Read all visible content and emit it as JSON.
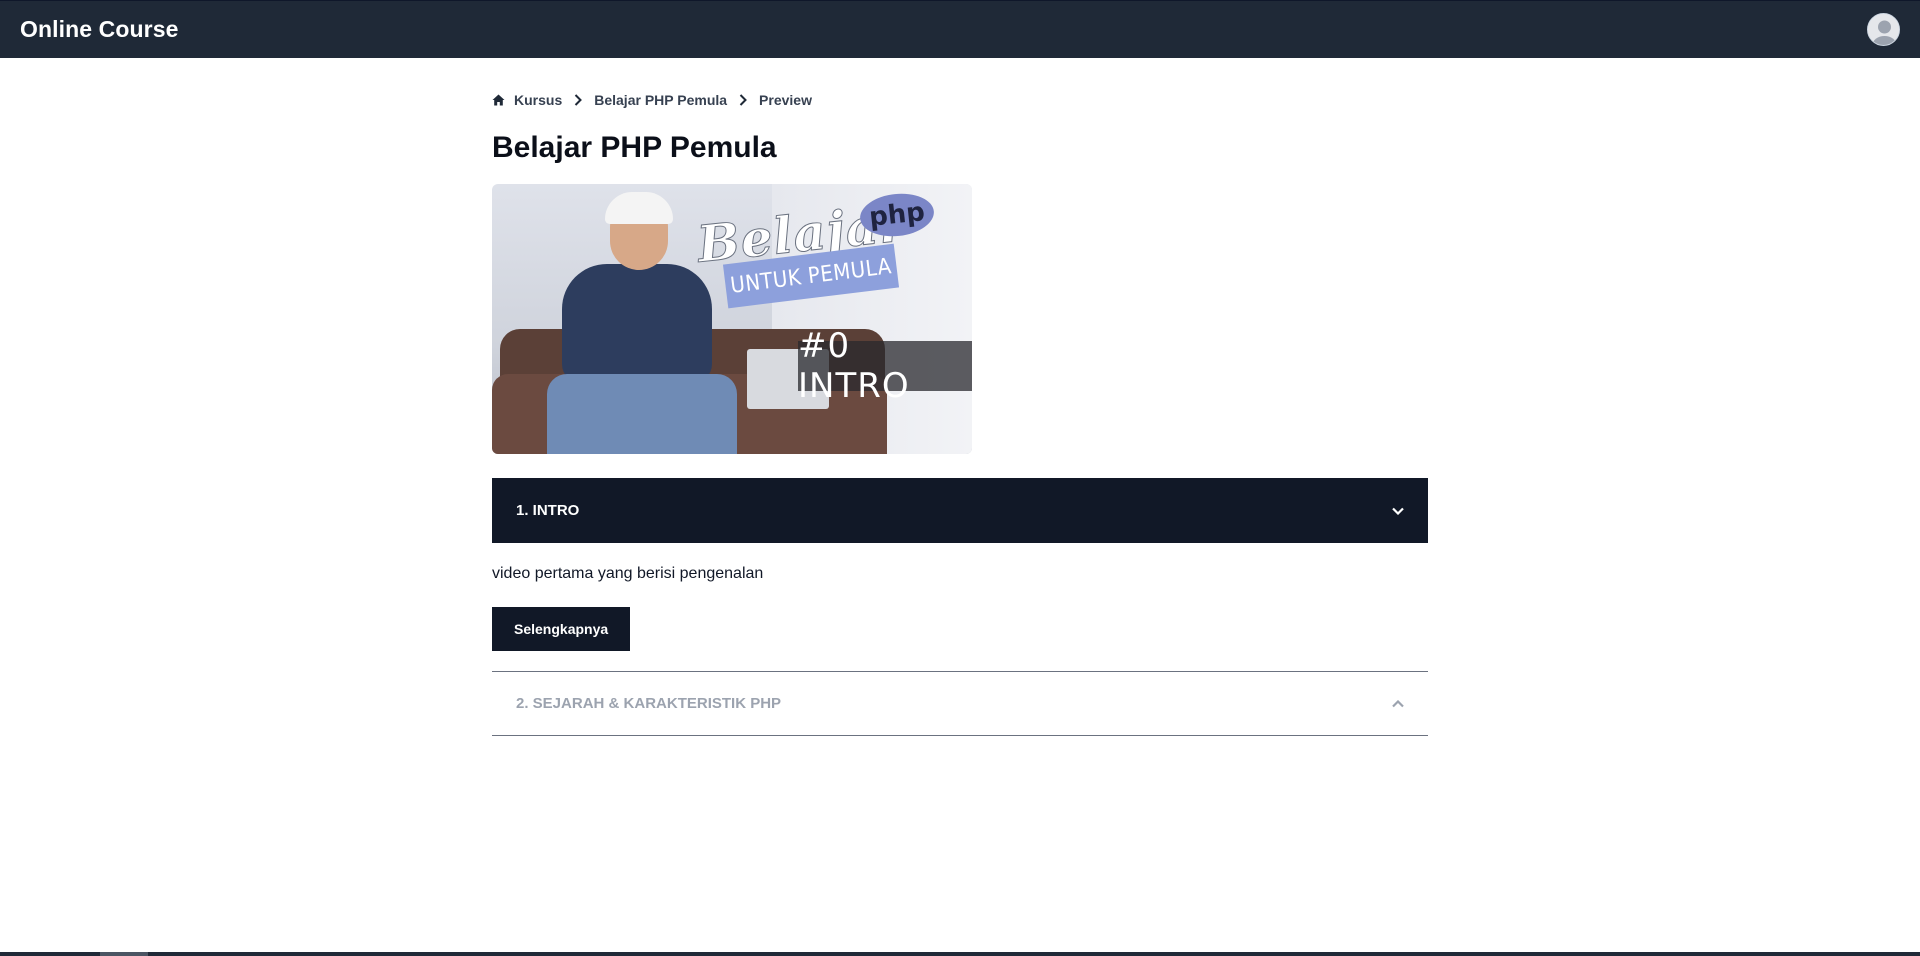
{
  "navbar": {
    "brand": "Online Course",
    "avatar_icon": "user-avatar-icon"
  },
  "breadcrumb": {
    "items": [
      "Kursus",
      "Belajar PHP Pemula",
      "Preview"
    ],
    "home_icon": "home-icon",
    "separator_icon": "chevron-right-icon"
  },
  "page": {
    "title": "Belajar PHP Pemula"
  },
  "thumbnail": {
    "title_script": "Belajar",
    "badge": "php",
    "subtitle": "UNTUK PEMULA",
    "episode": "#0 INTRO"
  },
  "accordion": {
    "items": [
      {
        "title": "1. INTRO",
        "expanded": true,
        "description": "video pertama yang berisi pengenalan",
        "button_label": "Selengkapnya",
        "icon": "chevron-down-icon"
      },
      {
        "title": "2. SEJARAH & KARAKTERISTIK PHP",
        "expanded": false,
        "icon": "chevron-up-icon"
      }
    ]
  },
  "colors": {
    "navbar_bg": "#1f2937",
    "accent_dark": "#111827",
    "muted_text": "#9ca3af"
  }
}
